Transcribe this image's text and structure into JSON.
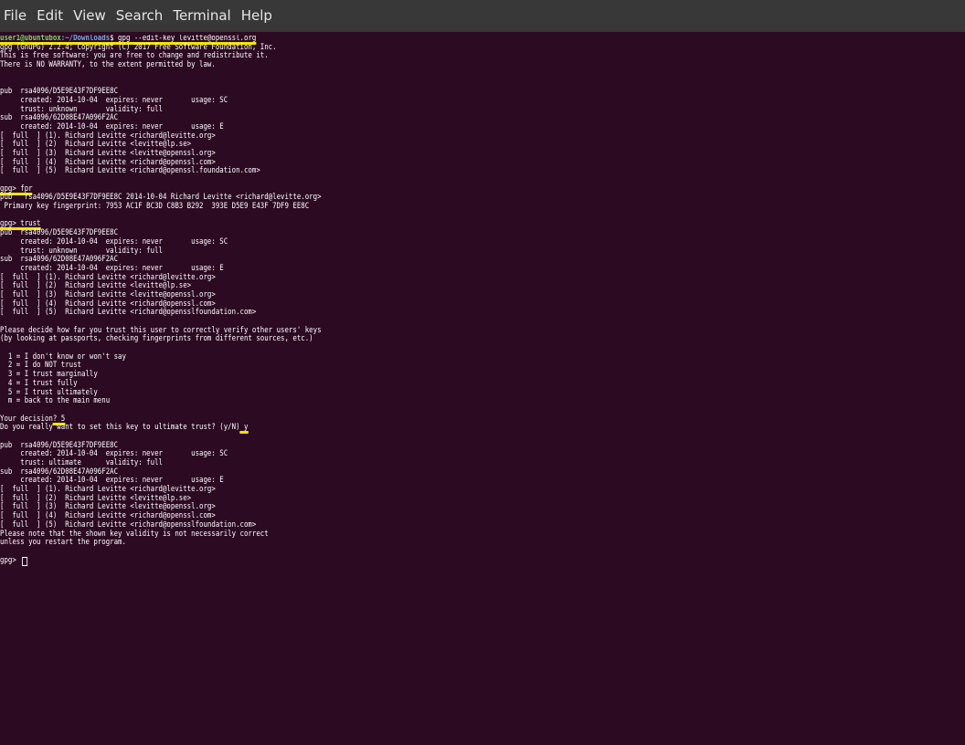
{
  "menu": [
    "File",
    "Edit",
    "View",
    "Search",
    "Terminal",
    "Help"
  ],
  "prompt": {
    "user_host": "user1@ubuntubox",
    "path": ":~/Downloads",
    "symbol": "$ ",
    "command": "gpg --edit-key levitte@openssl.org"
  },
  "lines": {
    "l1": "gpg (GnuPG) 2.2.4; Copyright (C) 2017 Free Software Foundation, Inc.",
    "l2": "This is free software: you are free to change and redistribute it.",
    "l3": "There is NO WARRANTY, to the extent permitted by law.",
    "l4": "",
    "l5": "",
    "l6": "pub  rsa4096/D5E9E43F7DF9EE8C",
    "l7": "     created: 2014-10-04  expires: never       usage: SC",
    "l8": "     trust: unknown       validity: full",
    "l9": "sub  rsa4096/62D08E47A096F2AC",
    "l10": "     created: 2014-10-04  expires: never       usage: E",
    "l11": "[  full  ] (1). Richard Levitte <richard@levitte.org>",
    "l12": "[  full  ] (2)  Richard Levitte <levitte@lp.se>",
    "l13": "[  full  ] (3)  Richard Levitte <levitte@openssl.org>",
    "l14": "[  full  ] (4)  Richard Levitte <richard@openssl.com>",
    "l15": "[  full  ] (5)  Richard Levitte <richard@openssl.foundation.com>",
    "l16": "",
    "l17_prompt": "gpg> ",
    "l17_cmd": "fpr",
    "l18": "pub   rsa4096/D5E9E43F7DF9EE8C 2014-10-04 Richard Levitte <richard@levitte.org>",
    "l19": " Primary key fingerprint: 7953 AC1F BC3D C8B3 B292  393E D5E9 E43F 7DF9 EE8C",
    "l20": "",
    "l21_prompt": "gpg> ",
    "l21_cmd": "trust",
    "l22": "pub  rsa4096/D5E9E43F7DF9EE8C",
    "l23": "     created: 2014-10-04  expires: never       usage: SC",
    "l24": "     trust: unknown       validity: full",
    "l25": "sub  rsa4096/62D08E47A096F2AC",
    "l26": "     created: 2014-10-04  expires: never       usage: E",
    "l27": "[  full  ] (1). Richard Levitte <richard@levitte.org>",
    "l28": "[  full  ] (2)  Richard Levitte <levitte@lp.se>",
    "l29": "[  full  ] (3)  Richard Levitte <levitte@openssl.org>",
    "l30": "[  full  ] (4)  Richard Levitte <richard@openssl.com>",
    "l31": "[  full  ] (5)  Richard Levitte <richard@opensslfoundation.com>",
    "l32": "",
    "l33": "Please decide how far you trust this user to correctly verify other users' keys",
    "l34": "(by looking at passports, checking fingerprints from different sources, etc.)",
    "l35": "",
    "l36": "  1 = I don't know or won't say",
    "l37": "  2 = I do NOT trust",
    "l38": "  3 = I trust marginally",
    "l39": "  4 = I trust fully",
    "l40": "  5 = I trust ultimately",
    "l41": "  m = back to the main menu",
    "l42": "",
    "l43_prompt": "Your decision",
    "l43_cmd": "? 5",
    "l44_prompt": "Do you really want to set this key to ultimate trust? (y/N)",
    "l44_cmd": " y",
    "l45": "",
    "l46": "pub  rsa4096/D5E9E43F7DF9EE8C",
    "l47": "     created: 2014-10-04  expires: never       usage: SC",
    "l48": "     trust: ultimate      validity: full",
    "l49": "sub  rsa4096/62D08E47A096F2AC",
    "l50": "     created: 2014-10-04  expires: never       usage: E",
    "l51": "[  full  ] (1). Richard Levitte <richard@levitte.org>",
    "l52": "[  full  ] (2)  Richard Levitte <levitte@lp.se>",
    "l53": "[  full  ] (3)  Richard Levitte <levitte@openssl.org>",
    "l54": "[  full  ] (4)  Richard Levitte <richard@openssl.com>",
    "l55": "[  full  ] (5)  Richard Levitte <richard@opensslfoundation.com>",
    "l56": "Please note that the shown key validity is not necessarily correct",
    "l57": "unless you restart the program.",
    "l58": "",
    "l59_prompt": "gpg> "
  },
  "colors": {
    "background": "#2c0a22",
    "menubar": "#383838",
    "highlight": "#f2e400",
    "prompt_user": "#7fd35c",
    "prompt_path": "#7aa6da"
  }
}
